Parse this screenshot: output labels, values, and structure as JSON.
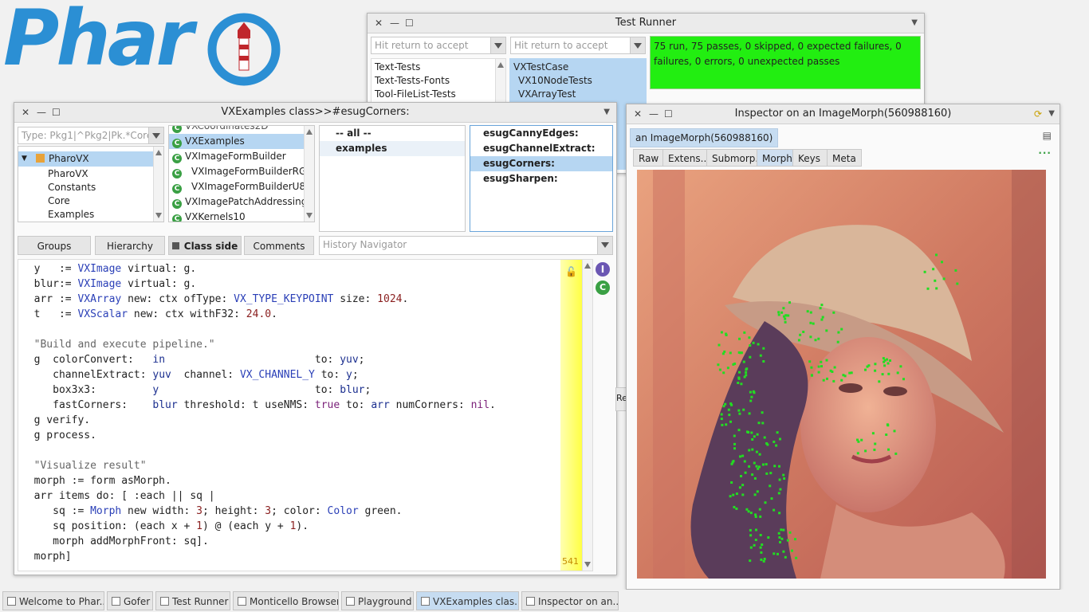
{
  "logo": {
    "text": "Phar"
  },
  "test_runner": {
    "title": "Test Runner",
    "filter1_placeholder": "Hit return to accept",
    "filter2_placeholder": "Hit return to accept",
    "packages": [
      "Text-Tests",
      "Text-Tests-Fonts",
      "Tool-FileList-Tests"
    ],
    "classes": [
      "VXTestCase",
      "VX10NodeTests",
      "VXArrayTest"
    ],
    "result": "75 run, 75 passes, 0 skipped, 0 expected failures, 0 failures, 0 errors, 0 unexpected passes",
    "result_color": "#22ee11"
  },
  "browser": {
    "title": "VXExamples class>>#esugCorners:",
    "package_filter_placeholder": "Type: Pkg1|^Pkg2|Pk.*Core$",
    "packages": [
      {
        "label": "PharoVX",
        "selected": true
      },
      {
        "label": "PharoVX",
        "selected": false
      },
      {
        "label": "Constants",
        "selected": false
      },
      {
        "label": "Core",
        "selected": false
      },
      {
        "label": "Examples",
        "selected": false
      }
    ],
    "classes_top_cut": "VXCoordinates2D",
    "classes": [
      {
        "label": "VXExamples",
        "selected": true,
        "indent": false
      },
      {
        "label": "VXImageFormBuilder",
        "selected": false,
        "indent": false
      },
      {
        "label": "VXImageFormBuilderRGB",
        "selected": false,
        "indent": true
      },
      {
        "label": "VXImageFormBuilderU8",
        "selected": false,
        "indent": true
      },
      {
        "label": "VXImagePatchAddressing",
        "selected": false,
        "indent": false
      },
      {
        "label": "VXKernels10",
        "selected": false,
        "indent": false
      }
    ],
    "protocols": [
      {
        "label": "-- all --",
        "selected": false
      },
      {
        "label": "examples",
        "selected": true
      }
    ],
    "methods": [
      {
        "label": "esugCannyEdges:",
        "selected": false
      },
      {
        "label": "esugChannelExtract:",
        "selected": false
      },
      {
        "label": "esugCorners:",
        "selected": true
      },
      {
        "label": "esugSharpen:",
        "selected": false
      }
    ],
    "buttons": {
      "groups": "Groups",
      "hierarchy": "Hierarchy",
      "class_side": "Class side",
      "comments": "Comments"
    },
    "history_placeholder": "History Navigator",
    "line_count": "541"
  },
  "code_lines": [
    [
      [
        "  y   := ",
        ""
      ],
      [
        "VXImage",
        "cls"
      ],
      [
        " virtual: g.",
        ""
      ]
    ],
    [
      [
        "  blur:= ",
        ""
      ],
      [
        "VXImage",
        "cls"
      ],
      [
        " virtual: g.",
        ""
      ]
    ],
    [
      [
        "  arr := ",
        ""
      ],
      [
        "VXArray",
        "cls"
      ],
      [
        " new: ctx ofType: ",
        ""
      ],
      [
        "VX_TYPE_KEYPOINT",
        "cls"
      ],
      [
        " size: ",
        ""
      ],
      [
        "1024",
        "num"
      ],
      [
        ".",
        ""
      ]
    ],
    [
      [
        "  t   := ",
        ""
      ],
      [
        "VXScalar",
        "cls"
      ],
      [
        " new: ctx withF32: ",
        ""
      ],
      [
        "24.0",
        "num"
      ],
      [
        ".",
        ""
      ]
    ],
    [
      [
        "",
        ""
      ]
    ],
    [
      [
        "  ",
        ""
      ],
      [
        "\"Build and execute pipeline.\"",
        "str"
      ]
    ],
    [
      [
        "  g  colorConvert:   ",
        ""
      ],
      [
        "in",
        "kw"
      ],
      [
        "                        to: ",
        ""
      ],
      [
        "yuv",
        "kw"
      ],
      [
        ";",
        ""
      ]
    ],
    [
      [
        "     channelExtract: ",
        ""
      ],
      [
        "yuv",
        "kw"
      ],
      [
        "  channel: ",
        ""
      ],
      [
        "VX_CHANNEL_Y",
        "cls"
      ],
      [
        " to: ",
        ""
      ],
      [
        "y",
        "kw"
      ],
      [
        ";",
        ""
      ]
    ],
    [
      [
        "     box3x3:         ",
        ""
      ],
      [
        "y",
        "kw"
      ],
      [
        "                         to: ",
        ""
      ],
      [
        "blur",
        "kw"
      ],
      [
        ";",
        ""
      ]
    ],
    [
      [
        "     fastCorners:    ",
        ""
      ],
      [
        "blur",
        "kw"
      ],
      [
        " threshold: t useNMS: ",
        ""
      ],
      [
        "true",
        "sym"
      ],
      [
        " to: ",
        ""
      ],
      [
        "arr",
        "kw"
      ],
      [
        " numCorners: ",
        ""
      ],
      [
        "nil",
        "sym"
      ],
      [
        ".",
        ""
      ]
    ],
    [
      [
        "  g verify.",
        ""
      ]
    ],
    [
      [
        "  g process.",
        ""
      ]
    ],
    [
      [
        "",
        ""
      ]
    ],
    [
      [
        "  ",
        ""
      ],
      [
        "\"Visualize result\"",
        "str"
      ]
    ],
    [
      [
        "  morph := form asMorph.",
        ""
      ]
    ],
    [
      [
        "  arr items do: [ :each || sq |",
        ""
      ]
    ],
    [
      [
        "     sq := ",
        ""
      ],
      [
        "Morph",
        "cls"
      ],
      [
        " new width: ",
        ""
      ],
      [
        "3",
        "num"
      ],
      [
        "; height: ",
        ""
      ],
      [
        "3",
        "num"
      ],
      [
        "; color: ",
        ""
      ],
      [
        "Color",
        "cls"
      ],
      [
        " green.",
        ""
      ]
    ],
    [
      [
        "     sq position: (each x + ",
        ""
      ],
      [
        "1",
        "num"
      ],
      [
        ") @ (each y + ",
        ""
      ],
      [
        "1",
        "num"
      ],
      [
        ").",
        ""
      ]
    ],
    [
      [
        "     morph addMorphFront: sq].",
        ""
      ]
    ],
    [
      [
        "  morph]",
        ""
      ]
    ]
  ],
  "inspector": {
    "title": "Inspector on an ImageMorph(560988160)",
    "object_tab": "an ImageMorph(560988160)",
    "tabs": [
      "Raw",
      "Extens...",
      "Submorp...",
      "Morph",
      "Keys",
      "Meta"
    ],
    "active_tab": "Morph",
    "behind_window_label": "Re",
    "more_icon": "ellipsis-icon",
    "corner_marker_color": "#22dd22"
  },
  "taskbar": {
    "items": [
      {
        "label": "Welcome to Phar...",
        "active": false
      },
      {
        "label": "Gofer",
        "active": false
      },
      {
        "label": "Test Runner",
        "active": false
      },
      {
        "label": "Monticello Browser",
        "active": false
      },
      {
        "label": "Playground",
        "active": false
      },
      {
        "label": "VXExamples clas...",
        "active": true
      },
      {
        "label": "Inspector on an...",
        "active": false
      }
    ]
  }
}
